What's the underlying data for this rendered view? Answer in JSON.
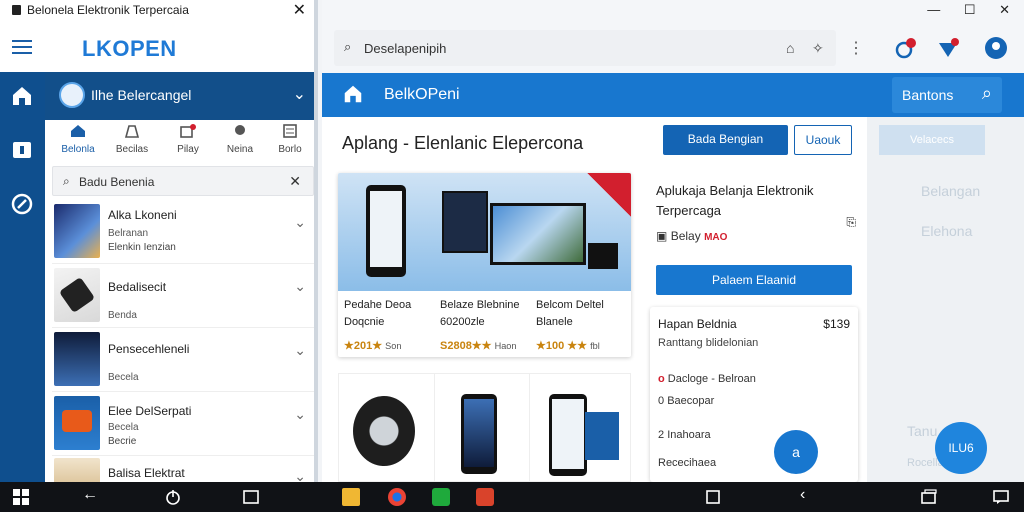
{
  "left": {
    "title": "Belonela Elektronik Terpercaia",
    "logo": "LKOPEN",
    "store_name": "Ilhe Belercangel",
    "categories": [
      "Belonla",
      "Becilas",
      "Pilay",
      "Neina",
      "Borlo"
    ],
    "search_value": "Badu Benenia",
    "items": [
      {
        "title": "Alka Lkoneni",
        "line2": "Belranan",
        "line3": "Elenkin Ienzian"
      },
      {
        "title": "Bedalisecit",
        "line2": "Benda",
        "line3": ""
      },
      {
        "title": "Pensecehleneli",
        "line2": "Becela",
        "line3": ""
      },
      {
        "title": "Elee DelSerpati",
        "line2": "Becela",
        "line3": "Becrie"
      },
      {
        "title": "Balisa Elektrat",
        "line2": "",
        "line3": ""
      }
    ]
  },
  "right": {
    "address": "Deselapenipih",
    "bar_title": "BelkOPeni",
    "search_label": "Bantons",
    "heading": "Aplang - Elenlanic Elepercona",
    "btn_primary": "Bada Bengian",
    "btn_secondary": "Uaouk",
    "products": [
      {
        "name": "Pedahe Deoa Doqcnie",
        "price": "★201★",
        "extra": "Son"
      },
      {
        "name": "Belaze Blebnine 60200zle",
        "price": "S2808★★",
        "extra": "Haon"
      },
      {
        "name": "Belcom Deltel Blanele",
        "price": "★100 ★★",
        "extra": "fbl"
      }
    ],
    "side_heading": "Aplukaja Belanja Elektronik Terpercaga",
    "side_tag_label": "Belay",
    "side_tag_value": "MAO",
    "side_button": "Palaem Elaanid",
    "card_title": "Hapan Beldnia",
    "card_price": "$139",
    "card_sub": "Ranttang blidelonian",
    "card_lines": [
      {
        "mark": "o",
        "label": "Dacloge",
        "extra": "Belroan"
      },
      {
        "mark": "0",
        "label": "Baecopar",
        "extra": ""
      },
      {
        "mark": "2",
        "label": "Inahoara",
        "extra": ""
      },
      {
        "mark": "",
        "label": "Rececihaea",
        "extra": ""
      }
    ],
    "fab_label": "a",
    "faded": {
      "button": "Velacecs",
      "t1": "Belangan",
      "t2": "Elehona",
      "t3": "Tanu",
      "t4": "Rocellaris"
    },
    "fab2_label": "ILU6"
  },
  "icons": [
    "home-icon",
    "search-icon",
    "back-icon",
    "power-icon",
    "square-icon",
    "close-icon"
  ],
  "colors": {
    "primary": "#1877cf",
    "dark": "#0f4f8e",
    "taskbar": "#101216"
  }
}
